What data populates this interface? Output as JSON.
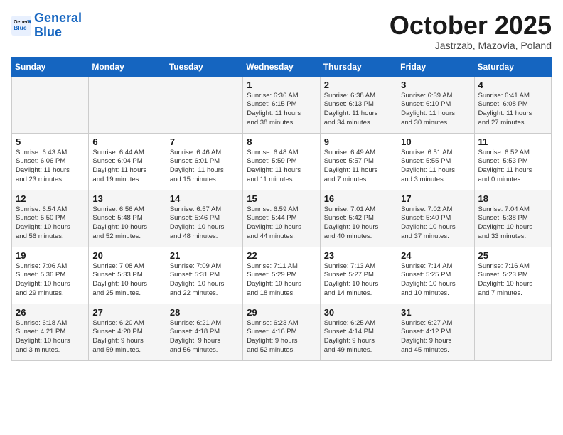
{
  "header": {
    "logo_general": "General",
    "logo_blue": "Blue",
    "month": "October 2025",
    "location": "Jastrzab, Mazovia, Poland"
  },
  "days_of_week": [
    "Sunday",
    "Monday",
    "Tuesday",
    "Wednesday",
    "Thursday",
    "Friday",
    "Saturday"
  ],
  "weeks": [
    [
      {
        "day": "",
        "text": ""
      },
      {
        "day": "",
        "text": ""
      },
      {
        "day": "",
        "text": ""
      },
      {
        "day": "1",
        "text": "Sunrise: 6:36 AM\nSunset: 6:15 PM\nDaylight: 11 hours\nand 38 minutes."
      },
      {
        "day": "2",
        "text": "Sunrise: 6:38 AM\nSunset: 6:13 PM\nDaylight: 11 hours\nand 34 minutes."
      },
      {
        "day": "3",
        "text": "Sunrise: 6:39 AM\nSunset: 6:10 PM\nDaylight: 11 hours\nand 30 minutes."
      },
      {
        "day": "4",
        "text": "Sunrise: 6:41 AM\nSunset: 6:08 PM\nDaylight: 11 hours\nand 27 minutes."
      }
    ],
    [
      {
        "day": "5",
        "text": "Sunrise: 6:43 AM\nSunset: 6:06 PM\nDaylight: 11 hours\nand 23 minutes."
      },
      {
        "day": "6",
        "text": "Sunrise: 6:44 AM\nSunset: 6:04 PM\nDaylight: 11 hours\nand 19 minutes."
      },
      {
        "day": "7",
        "text": "Sunrise: 6:46 AM\nSunset: 6:01 PM\nDaylight: 11 hours\nand 15 minutes."
      },
      {
        "day": "8",
        "text": "Sunrise: 6:48 AM\nSunset: 5:59 PM\nDaylight: 11 hours\nand 11 minutes."
      },
      {
        "day": "9",
        "text": "Sunrise: 6:49 AM\nSunset: 5:57 PM\nDaylight: 11 hours\nand 7 minutes."
      },
      {
        "day": "10",
        "text": "Sunrise: 6:51 AM\nSunset: 5:55 PM\nDaylight: 11 hours\nand 3 minutes."
      },
      {
        "day": "11",
        "text": "Sunrise: 6:52 AM\nSunset: 5:53 PM\nDaylight: 11 hours\nand 0 minutes."
      }
    ],
    [
      {
        "day": "12",
        "text": "Sunrise: 6:54 AM\nSunset: 5:50 PM\nDaylight: 10 hours\nand 56 minutes."
      },
      {
        "day": "13",
        "text": "Sunrise: 6:56 AM\nSunset: 5:48 PM\nDaylight: 10 hours\nand 52 minutes."
      },
      {
        "day": "14",
        "text": "Sunrise: 6:57 AM\nSunset: 5:46 PM\nDaylight: 10 hours\nand 48 minutes."
      },
      {
        "day": "15",
        "text": "Sunrise: 6:59 AM\nSunset: 5:44 PM\nDaylight: 10 hours\nand 44 minutes."
      },
      {
        "day": "16",
        "text": "Sunrise: 7:01 AM\nSunset: 5:42 PM\nDaylight: 10 hours\nand 40 minutes."
      },
      {
        "day": "17",
        "text": "Sunrise: 7:02 AM\nSunset: 5:40 PM\nDaylight: 10 hours\nand 37 minutes."
      },
      {
        "day": "18",
        "text": "Sunrise: 7:04 AM\nSunset: 5:38 PM\nDaylight: 10 hours\nand 33 minutes."
      }
    ],
    [
      {
        "day": "19",
        "text": "Sunrise: 7:06 AM\nSunset: 5:36 PM\nDaylight: 10 hours\nand 29 minutes."
      },
      {
        "day": "20",
        "text": "Sunrise: 7:08 AM\nSunset: 5:33 PM\nDaylight: 10 hours\nand 25 minutes."
      },
      {
        "day": "21",
        "text": "Sunrise: 7:09 AM\nSunset: 5:31 PM\nDaylight: 10 hours\nand 22 minutes."
      },
      {
        "day": "22",
        "text": "Sunrise: 7:11 AM\nSunset: 5:29 PM\nDaylight: 10 hours\nand 18 minutes."
      },
      {
        "day": "23",
        "text": "Sunrise: 7:13 AM\nSunset: 5:27 PM\nDaylight: 10 hours\nand 14 minutes."
      },
      {
        "day": "24",
        "text": "Sunrise: 7:14 AM\nSunset: 5:25 PM\nDaylight: 10 hours\nand 10 minutes."
      },
      {
        "day": "25",
        "text": "Sunrise: 7:16 AM\nSunset: 5:23 PM\nDaylight: 10 hours\nand 7 minutes."
      }
    ],
    [
      {
        "day": "26",
        "text": "Sunrise: 6:18 AM\nSunset: 4:21 PM\nDaylight: 10 hours\nand 3 minutes."
      },
      {
        "day": "27",
        "text": "Sunrise: 6:20 AM\nSunset: 4:20 PM\nDaylight: 9 hours\nand 59 minutes."
      },
      {
        "day": "28",
        "text": "Sunrise: 6:21 AM\nSunset: 4:18 PM\nDaylight: 9 hours\nand 56 minutes."
      },
      {
        "day": "29",
        "text": "Sunrise: 6:23 AM\nSunset: 4:16 PM\nDaylight: 9 hours\nand 52 minutes."
      },
      {
        "day": "30",
        "text": "Sunrise: 6:25 AM\nSunset: 4:14 PM\nDaylight: 9 hours\nand 49 minutes."
      },
      {
        "day": "31",
        "text": "Sunrise: 6:27 AM\nSunset: 4:12 PM\nDaylight: 9 hours\nand 45 minutes."
      },
      {
        "day": "",
        "text": ""
      }
    ]
  ]
}
